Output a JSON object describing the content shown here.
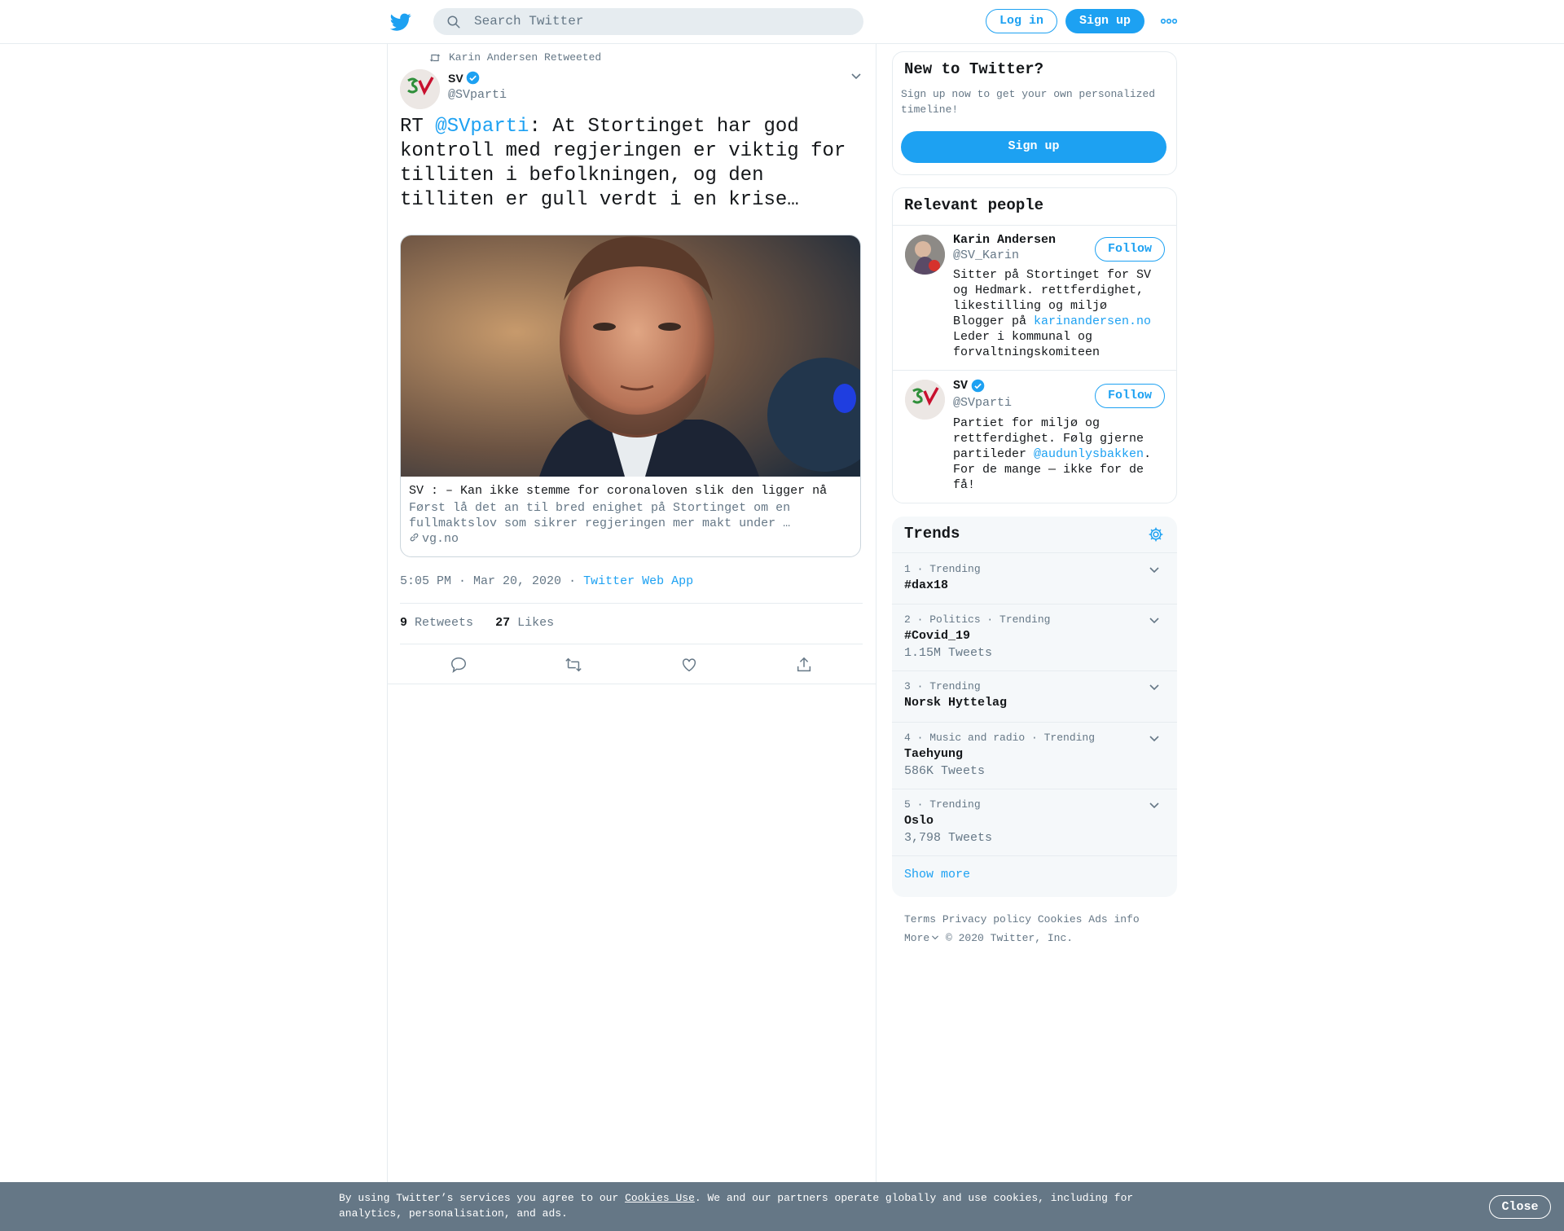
{
  "header": {
    "search_placeholder": "Search Twitter",
    "login_label": "Log in",
    "signup_label": "Sign up"
  },
  "tweet": {
    "retweeted_by": "Karin Andersen Retweeted",
    "author_name": "SV",
    "author_handle": "@SVparti",
    "text_prefix": "RT ",
    "text_mention": "@SVparti",
    "text_body": ": At Stortinget har god kontroll med regjeringen er viktig for tilliten i befolkningen, og den tilliten er gull verdt i en krise…",
    "card": {
      "title": "SV : – Kan ikke stemme for coronaloven slik den ligger nå",
      "description": "Først lå det an til bred enighet på Stortinget om en fullmaktslov som sikrer regjeringen mer makt under …",
      "domain": "vg.no"
    },
    "time": "5:05 PM · Mar 20, 2020",
    "source_sep": "·",
    "source": "Twitter Web App",
    "retweets_count": "9",
    "retweets_label": "Retweets",
    "likes_count": "27",
    "likes_label": "Likes"
  },
  "new_to_twitter": {
    "title": "New to Twitter?",
    "text": "Sign up now to get your own personalized timeline!",
    "button": "Sign up"
  },
  "relevant_people": {
    "title": "Relevant people",
    "people": [
      {
        "name": "Karin Andersen",
        "handle": "@SV_Karin",
        "bio_1": "Sitter på Stortinget for SV og Hedmark. rettferdighet, likestilling og miljø\nBlogger på ",
        "bio_link": "karinandersen.no",
        "bio_2": "\nLeder i kommunal og forvaltningskomiteen",
        "follow": "Follow"
      },
      {
        "name": "SV",
        "handle": "@SVparti",
        "bio_1": "Partiet for miljø og rettferdighet. Følg gjerne partileder ",
        "bio_link": "@audunlysbakken",
        "bio_2": ". For de mange — ikke for de få!",
        "follow": "Follow"
      }
    ]
  },
  "trends": {
    "title": "Trends",
    "items": [
      {
        "meta": "1 · Trending",
        "name": "#dax18",
        "count": ""
      },
      {
        "meta": "2 · Politics · Trending",
        "name": "#Covid_19",
        "count": "1.15M Tweets"
      },
      {
        "meta": "3 · Trending",
        "name": "Norsk Hyttelag",
        "count": ""
      },
      {
        "meta": "4 · Music and radio · Trending",
        "name": "Taehyung",
        "count": "586K Tweets"
      },
      {
        "meta": "5 · Trending",
        "name": "Oslo",
        "count": "3,798 Tweets"
      }
    ],
    "show_more": "Show more"
  },
  "footer": {
    "terms": "Terms",
    "privacy": "Privacy policy",
    "cookies": "Cookies",
    "ads": "Ads info",
    "more": "More",
    "copyright": "© 2020 Twitter, Inc."
  },
  "cookie_bar": {
    "text_1": "By using Twitter’s services you agree to our ",
    "link": "Cookies Use",
    "text_2": ". We and our partners operate globally and use cookies, including for analytics, personalisation, and ads.",
    "close": "Close"
  },
  "colors": {
    "accent": "#1da1f2",
    "text": "#14171a",
    "secondary": "#657786",
    "border": "#e6ecf0"
  }
}
